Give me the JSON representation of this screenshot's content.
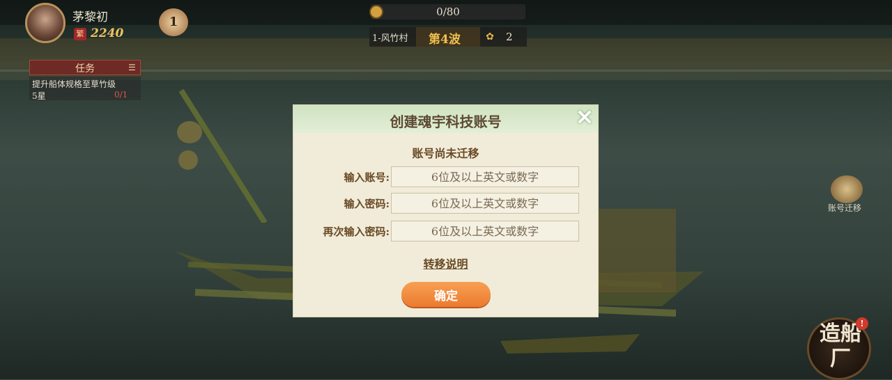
{
  "player": {
    "name": "茅黎初",
    "coin_icon_label": "繁",
    "coins": "2240",
    "level": "1"
  },
  "progress": {
    "text": "0/80",
    "fraction": 0
  },
  "stage": {
    "name": "1-风竹村",
    "wave": "第4波",
    "token_count": "2"
  },
  "task": {
    "title": "任务",
    "description": "提升船体规格至草竹级",
    "subtext": "5星",
    "count": "0/1"
  },
  "side": {
    "migrate_label": "账号迁移",
    "shipyard_label": "造船厂",
    "alert": "!"
  },
  "dialog": {
    "title": "创建魂宇科技账号",
    "close_icon": "✕",
    "subtitle": "账号尚未迁移",
    "fields": [
      {
        "label": "输入账号:",
        "placeholder": "6位及以上英文或数字"
      },
      {
        "label": "输入密码:",
        "placeholder": "6位及以上英文或数字"
      },
      {
        "label": "再次输入密码:",
        "placeholder": "6位及以上英文或数字"
      }
    ],
    "help_link": "转移说明",
    "confirm_label": "确定"
  }
}
